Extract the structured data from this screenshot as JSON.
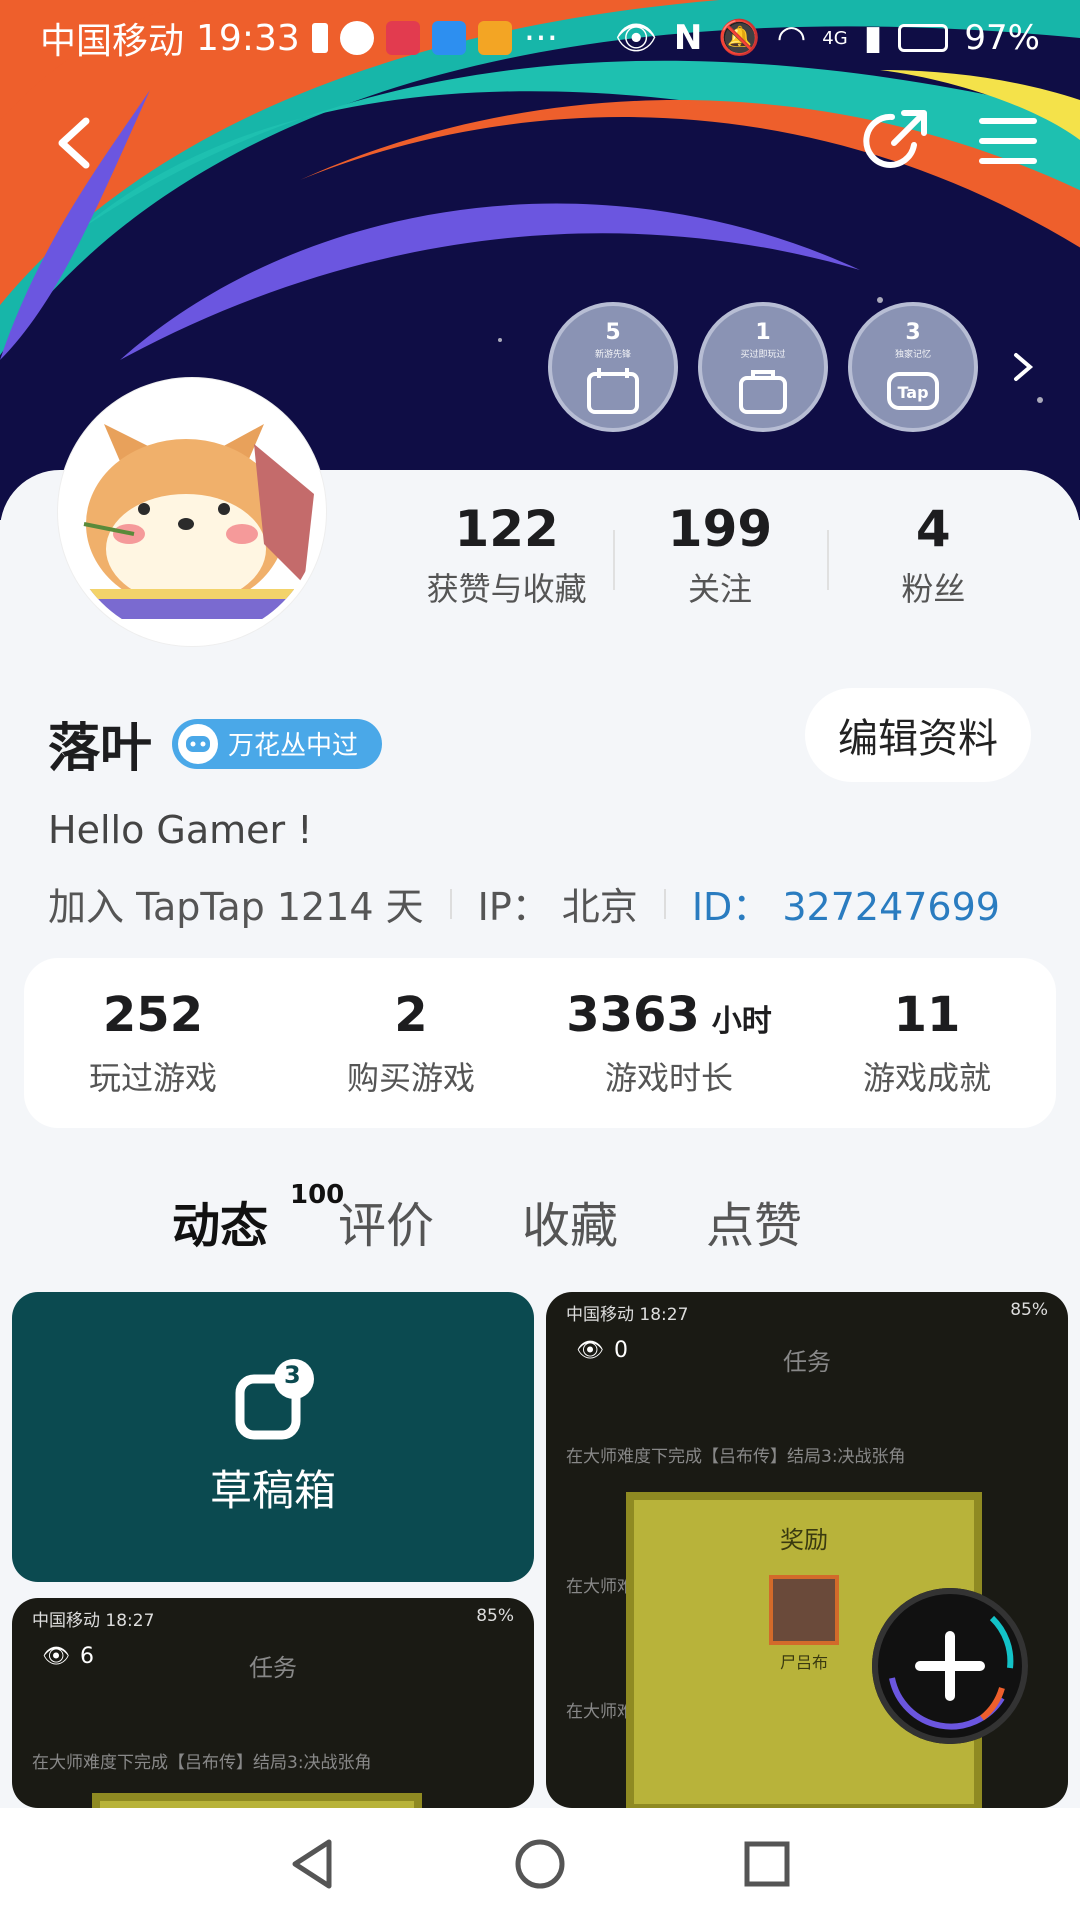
{
  "status_bar": {
    "carrier": "中国移动",
    "time": "19:33",
    "more": "···",
    "battery": "97%",
    "network": "4G"
  },
  "badges": [
    {
      "num": "5",
      "text": "新游先锋"
    },
    {
      "num": "1",
      "text": "买过即玩过"
    },
    {
      "num": "3",
      "text": "独家记忆"
    }
  ],
  "profile": {
    "likes_value": "122",
    "likes_label": "获赞与收藏",
    "following_value": "199",
    "following_label": "关注",
    "fans_value": "4",
    "fans_label": "粉丝",
    "name": "落叶",
    "tag": "万花丛中过",
    "edit_label": "编辑资料",
    "bio": "Hello Gamer !",
    "joined": "加入 TapTap 1214 天",
    "ip": "IP：  北京",
    "id": "ID：  327247699"
  },
  "game_stats": [
    {
      "value": "252",
      "unit": "",
      "label": "玩过游戏"
    },
    {
      "value": "2",
      "unit": "",
      "label": "购买游戏"
    },
    {
      "value": "3363",
      "unit": "小时",
      "label": "游戏时长"
    },
    {
      "value": "11",
      "unit": "",
      "label": "游戏成就"
    }
  ],
  "tabs": {
    "active": "动态",
    "active_count": "100",
    "items": [
      "评价",
      "收藏",
      "点赞"
    ]
  },
  "draft": {
    "label": "草稿箱",
    "count": "3"
  },
  "shots": [
    {
      "carrier": "中国移动 18:27",
      "battery": "85%",
      "views": "0",
      "title": "任务",
      "line": "在大师难度下完成【吕布传】结局3:决战张角",
      "reward": "奖励",
      "item": "尸吕布",
      "short1": "在大师难",
      "short2": "在大师难"
    },
    {
      "carrier": "中国移动 18:27",
      "battery": "85%",
      "views": "6",
      "title": "任务",
      "line": "在大师难度下完成【吕布传】结局3:决战张角"
    }
  ],
  "colors": {
    "accent": "#13c3c8",
    "id_blue": "#2a7cc0",
    "draft_bg": "#0b4a50",
    "tag_blue": "#4aa8e8"
  }
}
